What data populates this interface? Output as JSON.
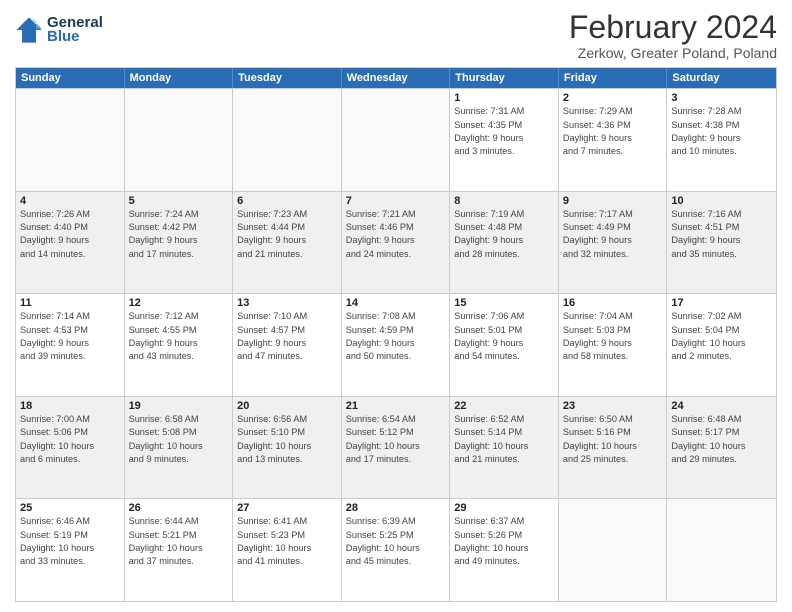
{
  "header": {
    "logo_line1": "General",
    "logo_line2": "Blue",
    "month_title": "February 2024",
    "subtitle": "Zerkow, Greater Poland, Poland"
  },
  "days_of_week": [
    "Sunday",
    "Monday",
    "Tuesday",
    "Wednesday",
    "Thursday",
    "Friday",
    "Saturday"
  ],
  "rows": [
    [
      {
        "day": "",
        "info": "",
        "empty": true
      },
      {
        "day": "",
        "info": "",
        "empty": true
      },
      {
        "day": "",
        "info": "",
        "empty": true
      },
      {
        "day": "",
        "info": "",
        "empty": true
      },
      {
        "day": "1",
        "info": "Sunrise: 7:31 AM\nSunset: 4:35 PM\nDaylight: 9 hours\nand 3 minutes."
      },
      {
        "day": "2",
        "info": "Sunrise: 7:29 AM\nSunset: 4:36 PM\nDaylight: 9 hours\nand 7 minutes."
      },
      {
        "day": "3",
        "info": "Sunrise: 7:28 AM\nSunset: 4:38 PM\nDaylight: 9 hours\nand 10 minutes."
      }
    ],
    [
      {
        "day": "4",
        "info": "Sunrise: 7:26 AM\nSunset: 4:40 PM\nDaylight: 9 hours\nand 14 minutes.",
        "shaded": true
      },
      {
        "day": "5",
        "info": "Sunrise: 7:24 AM\nSunset: 4:42 PM\nDaylight: 9 hours\nand 17 minutes.",
        "shaded": true
      },
      {
        "day": "6",
        "info": "Sunrise: 7:23 AM\nSunset: 4:44 PM\nDaylight: 9 hours\nand 21 minutes.",
        "shaded": true
      },
      {
        "day": "7",
        "info": "Sunrise: 7:21 AM\nSunset: 4:46 PM\nDaylight: 9 hours\nand 24 minutes.",
        "shaded": true
      },
      {
        "day": "8",
        "info": "Sunrise: 7:19 AM\nSunset: 4:48 PM\nDaylight: 9 hours\nand 28 minutes.",
        "shaded": true
      },
      {
        "day": "9",
        "info": "Sunrise: 7:17 AM\nSunset: 4:49 PM\nDaylight: 9 hours\nand 32 minutes.",
        "shaded": true
      },
      {
        "day": "10",
        "info": "Sunrise: 7:16 AM\nSunset: 4:51 PM\nDaylight: 9 hours\nand 35 minutes.",
        "shaded": true
      }
    ],
    [
      {
        "day": "11",
        "info": "Sunrise: 7:14 AM\nSunset: 4:53 PM\nDaylight: 9 hours\nand 39 minutes."
      },
      {
        "day": "12",
        "info": "Sunrise: 7:12 AM\nSunset: 4:55 PM\nDaylight: 9 hours\nand 43 minutes."
      },
      {
        "day": "13",
        "info": "Sunrise: 7:10 AM\nSunset: 4:57 PM\nDaylight: 9 hours\nand 47 minutes."
      },
      {
        "day": "14",
        "info": "Sunrise: 7:08 AM\nSunset: 4:59 PM\nDaylight: 9 hours\nand 50 minutes."
      },
      {
        "day": "15",
        "info": "Sunrise: 7:06 AM\nSunset: 5:01 PM\nDaylight: 9 hours\nand 54 minutes."
      },
      {
        "day": "16",
        "info": "Sunrise: 7:04 AM\nSunset: 5:03 PM\nDaylight: 9 hours\nand 58 minutes."
      },
      {
        "day": "17",
        "info": "Sunrise: 7:02 AM\nSunset: 5:04 PM\nDaylight: 10 hours\nand 2 minutes."
      }
    ],
    [
      {
        "day": "18",
        "info": "Sunrise: 7:00 AM\nSunset: 5:06 PM\nDaylight: 10 hours\nand 6 minutes.",
        "shaded": true
      },
      {
        "day": "19",
        "info": "Sunrise: 6:58 AM\nSunset: 5:08 PM\nDaylight: 10 hours\nand 9 minutes.",
        "shaded": true
      },
      {
        "day": "20",
        "info": "Sunrise: 6:56 AM\nSunset: 5:10 PM\nDaylight: 10 hours\nand 13 minutes.",
        "shaded": true
      },
      {
        "day": "21",
        "info": "Sunrise: 6:54 AM\nSunset: 5:12 PM\nDaylight: 10 hours\nand 17 minutes.",
        "shaded": true
      },
      {
        "day": "22",
        "info": "Sunrise: 6:52 AM\nSunset: 5:14 PM\nDaylight: 10 hours\nand 21 minutes.",
        "shaded": true
      },
      {
        "day": "23",
        "info": "Sunrise: 6:50 AM\nSunset: 5:16 PM\nDaylight: 10 hours\nand 25 minutes.",
        "shaded": true
      },
      {
        "day": "24",
        "info": "Sunrise: 6:48 AM\nSunset: 5:17 PM\nDaylight: 10 hours\nand 29 minutes.",
        "shaded": true
      }
    ],
    [
      {
        "day": "25",
        "info": "Sunrise: 6:46 AM\nSunset: 5:19 PM\nDaylight: 10 hours\nand 33 minutes."
      },
      {
        "day": "26",
        "info": "Sunrise: 6:44 AM\nSunset: 5:21 PM\nDaylight: 10 hours\nand 37 minutes."
      },
      {
        "day": "27",
        "info": "Sunrise: 6:41 AM\nSunset: 5:23 PM\nDaylight: 10 hours\nand 41 minutes."
      },
      {
        "day": "28",
        "info": "Sunrise: 6:39 AM\nSunset: 5:25 PM\nDaylight: 10 hours\nand 45 minutes."
      },
      {
        "day": "29",
        "info": "Sunrise: 6:37 AM\nSunset: 5:26 PM\nDaylight: 10 hours\nand 49 minutes."
      },
      {
        "day": "",
        "info": "",
        "empty": true
      },
      {
        "day": "",
        "info": "",
        "empty": true
      }
    ]
  ]
}
